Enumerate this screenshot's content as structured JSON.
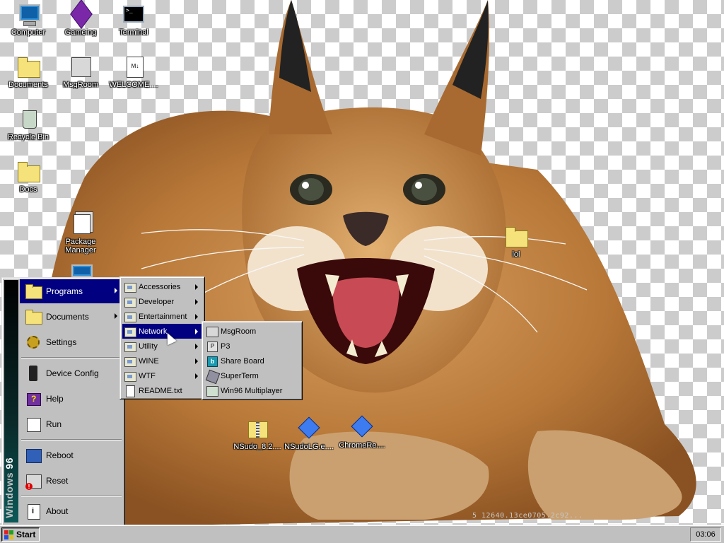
{
  "desktop": {
    "icons": {
      "computer": "Computer",
      "gameing": "Gameing",
      "terminal": "Terminal",
      "documents": "Documents",
      "msgroom": "MsgRoom",
      "welcome": "WELCOME....",
      "recycle_bin": "Recycle Bin",
      "docs": "Docs",
      "package_manager_line1": "Package",
      "package_manager_line2": "Manager",
      "lol": "lol",
      "nsudo": "NSudo_8.2....",
      "nsudolg": "NSudoLG.e....",
      "chromere": "ChromeRe...."
    },
    "welcome_icon_text": "M↓",
    "terminal_icon_text": ">_",
    "build_text": "5 12640.13ce0705.2c92..."
  },
  "start_menu": {
    "banner_bold": "Windows",
    "banner_light": " 96",
    "items": {
      "programs": "Programs",
      "documents": "Documents",
      "settings": "Settings",
      "device_config": "Device Config",
      "help": "Help",
      "run": "Run",
      "reboot": "Reboot",
      "reset": "Reset",
      "about": "About"
    }
  },
  "programs_menu": {
    "accessories": "Accessories",
    "developer": "Developer",
    "entertainment": "Entertainment",
    "network": "Network",
    "utility": "Utility",
    "wine": "WINE",
    "wtf": "WTF",
    "readme": "README.txt"
  },
  "network_menu": {
    "msgroom": "MsgRoom",
    "p3": "P3",
    "share_board": "Share Board",
    "superterm": "SuperTerm",
    "win96_multiplayer": "Win96 Multiplayer",
    "p3_icon_text": "P",
    "share_icon_text": "b"
  },
  "taskbar": {
    "start_label": "Start",
    "clock": "03:06"
  },
  "colors": {
    "menu_highlight": "#000080",
    "menu_face": "#c0c0c0"
  }
}
